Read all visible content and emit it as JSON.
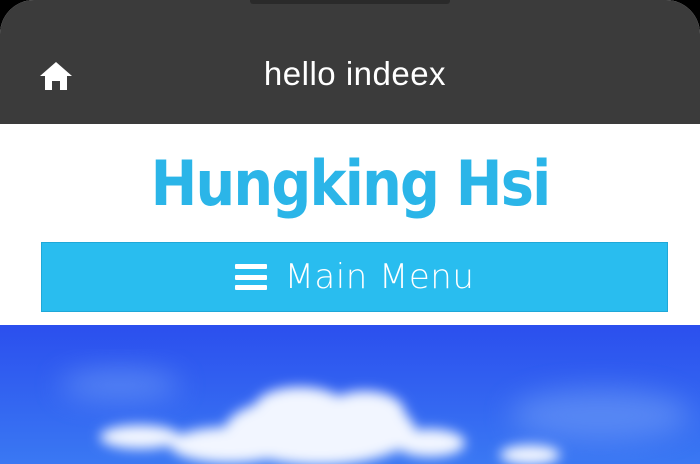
{
  "app_bar": {
    "title": "hello indeex",
    "home_icon": "home-icon"
  },
  "site": {
    "title": "Hungking Hsi",
    "menu_label": "Main Menu",
    "menu_icon": "hamburger-menu-icon"
  },
  "hero": {
    "image": "sky-clouds-image"
  },
  "colors": {
    "app_bar_bg": "#3b3b3b",
    "site_title": "#2bb5e8",
    "menu_bg": "#29bdef",
    "hero_sky": "#2e52f0"
  }
}
